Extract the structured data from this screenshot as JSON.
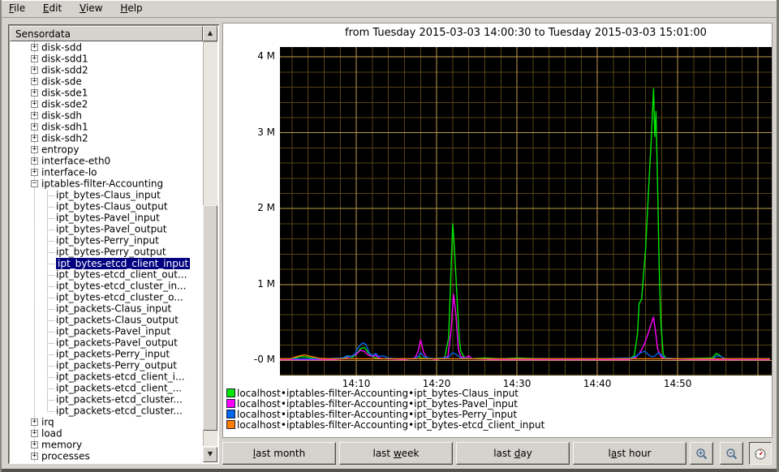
{
  "menubar": {
    "items": [
      {
        "pre": "",
        "m": "F",
        "post": "ile"
      },
      {
        "pre": "",
        "m": "E",
        "post": "dit"
      },
      {
        "pre": "",
        "m": "V",
        "post": "iew"
      },
      {
        "pre": "",
        "m": "H",
        "post": "elp"
      }
    ]
  },
  "sidebar": {
    "header": "Sensordata",
    "items": [
      {
        "label": "disk-sdd",
        "level": 0,
        "expander": "plus"
      },
      {
        "label": "disk-sdd1",
        "level": 0,
        "expander": "plus"
      },
      {
        "label": "disk-sdd2",
        "level": 0,
        "expander": "plus"
      },
      {
        "label": "disk-sde",
        "level": 0,
        "expander": "plus"
      },
      {
        "label": "disk-sde1",
        "level": 0,
        "expander": "plus"
      },
      {
        "label": "disk-sde2",
        "level": 0,
        "expander": "plus"
      },
      {
        "label": "disk-sdh",
        "level": 0,
        "expander": "plus"
      },
      {
        "label": "disk-sdh1",
        "level": 0,
        "expander": "plus"
      },
      {
        "label": "disk-sdh2",
        "level": 0,
        "expander": "plus"
      },
      {
        "label": "entropy",
        "level": 0,
        "expander": "plus"
      },
      {
        "label": "interface-eth0",
        "level": 0,
        "expander": "plus"
      },
      {
        "label": "interface-lo",
        "level": 0,
        "expander": "plus"
      },
      {
        "label": "iptables-filter-Accounting",
        "level": 0,
        "expander": "minus"
      },
      {
        "label": "ipt_bytes-Claus_input",
        "level": 1
      },
      {
        "label": "ipt_bytes-Claus_output",
        "level": 1
      },
      {
        "label": "ipt_bytes-Pavel_input",
        "level": 1
      },
      {
        "label": "ipt_bytes-Pavel_output",
        "level": 1
      },
      {
        "label": "ipt_bytes-Perry_input",
        "level": 1
      },
      {
        "label": "ipt_bytes-Perry_output",
        "level": 1
      },
      {
        "label": "ipt_bytes-etcd_client_input",
        "level": 1,
        "selected": true
      },
      {
        "label": "ipt_bytes-etcd_client_out...",
        "level": 1
      },
      {
        "label": "ipt_bytes-etcd_cluster_in...",
        "level": 1
      },
      {
        "label": "ipt_bytes-etcd_cluster_o...",
        "level": 1
      },
      {
        "label": "ipt_packets-Claus_input",
        "level": 1
      },
      {
        "label": "ipt_packets-Claus_output",
        "level": 1
      },
      {
        "label": "ipt_packets-Pavel_input",
        "level": 1
      },
      {
        "label": "ipt_packets-Pavel_output",
        "level": 1
      },
      {
        "label": "ipt_packets-Perry_input",
        "level": 1
      },
      {
        "label": "ipt_packets-Perry_output",
        "level": 1
      },
      {
        "label": "ipt_packets-etcd_client_i...",
        "level": 1
      },
      {
        "label": "ipt_packets-etcd_client_...",
        "level": 1
      },
      {
        "label": "ipt_packets-etcd_cluster...",
        "level": 1
      },
      {
        "label": "ipt_packets-etcd_cluster...",
        "level": 1
      },
      {
        "label": "irq",
        "level": 0,
        "expander": "plus"
      },
      {
        "label": "load",
        "level": 0,
        "expander": "plus"
      },
      {
        "label": "memory",
        "level": 0,
        "expander": "plus"
      },
      {
        "label": "processes",
        "level": 0,
        "expander": "plus"
      }
    ]
  },
  "chart_data": {
    "type": "line",
    "title": "from Tuesday 2015-03-03 14:00:30 to Tuesday 2015-03-03 15:01:00",
    "xlabel": "",
    "ylabel": "",
    "x_unit": "minutes after 14:00",
    "x_range": [
      0.5,
      61.7
    ],
    "y_range_M": [
      -0.2,
      4.13
    ],
    "plot_bg": "#000000",
    "grid": {
      "minor_color": "#564413",
      "major_color": "#bf9b4f",
      "minor_dx_min": 2,
      "major_dx_min": 10,
      "minor_dy_M": 0.2,
      "major_dy_M": 1
    },
    "yticks": [
      {
        "v": 4,
        "label": "4 M"
      },
      {
        "v": 3,
        "label": "3 M"
      },
      {
        "v": 2,
        "label": "2 M"
      },
      {
        "v": 1,
        "label": "1 M"
      },
      {
        "v": 0,
        "label": "-0 M"
      }
    ],
    "xticks": [
      {
        "t": 10,
        "label": "14:10"
      },
      {
        "t": 20,
        "label": "14:20"
      },
      {
        "t": 30,
        "label": "14:30"
      },
      {
        "t": 40,
        "label": "14:40"
      },
      {
        "t": 50,
        "label": "14:50"
      }
    ],
    "series": [
      {
        "name": "localhost•iptables-filter-Accounting•ipt_bytes-Claus_input",
        "color": "#00e800",
        "points": [
          [
            0.5,
            0.02
          ],
          [
            2,
            0.02
          ],
          [
            2.5,
            0.03
          ],
          [
            3,
            0.05
          ],
          [
            4,
            0.04
          ],
          [
            5,
            0.02
          ],
          [
            7,
            0.02
          ],
          [
            8.5,
            0.03
          ],
          [
            9,
            0.06
          ],
          [
            9.5,
            0.04
          ],
          [
            10,
            0.08
          ],
          [
            10.5,
            0.15
          ],
          [
            11,
            0.17
          ],
          [
            11.5,
            0.1
          ],
          [
            12,
            0.05
          ],
          [
            12.5,
            0.03
          ],
          [
            13,
            0.02
          ],
          [
            14,
            0.02
          ],
          [
            17,
            0.02
          ],
          [
            17.8,
            0.05
          ],
          [
            18,
            0.03
          ],
          [
            19,
            0.02
          ],
          [
            21,
            0.03
          ],
          [
            21.5,
            0.3
          ],
          [
            22,
            1.8
          ],
          [
            22.2,
            1.5
          ],
          [
            22.4,
            1.1
          ],
          [
            22.8,
            0.3
          ],
          [
            23,
            0.12
          ],
          [
            23.5,
            0.03
          ],
          [
            24,
            0.02
          ],
          [
            26,
            0.03
          ],
          [
            28,
            0.02
          ],
          [
            30,
            0.03
          ],
          [
            33,
            0.02
          ],
          [
            36,
            0.02
          ],
          [
            40,
            0.02
          ],
          [
            44,
            0.02
          ],
          [
            44.6,
            0.06
          ],
          [
            45,
            0.35
          ],
          [
            45.2,
            0.75
          ],
          [
            45.5,
            0.8
          ],
          [
            46,
            1.45
          ],
          [
            46.4,
            2.3
          ],
          [
            46.7,
            2.9
          ],
          [
            47,
            3.58
          ],
          [
            47.15,
            2.95
          ],
          [
            47.3,
            3.28
          ],
          [
            47.5,
            2.3
          ],
          [
            47.7,
            1.2
          ],
          [
            47.9,
            0.5
          ],
          [
            48.2,
            0.08
          ],
          [
            48.5,
            0.03
          ],
          [
            50,
            0.02
          ],
          [
            54.3,
            0.03
          ],
          [
            54.8,
            0.09
          ],
          [
            55.3,
            0.06
          ],
          [
            55.8,
            0.02
          ],
          [
            58,
            0.02
          ],
          [
            61.5,
            0.02
          ]
        ]
      },
      {
        "name": "localhost•iptables-filter-Accounting•ipt_bytes-Pavel_input",
        "color": "#ff00ff",
        "points": [
          [
            0.5,
            0.01
          ],
          [
            7,
            0.01
          ],
          [
            8.5,
            0.02
          ],
          [
            9,
            0.04
          ],
          [
            9.5,
            0.06
          ],
          [
            10,
            0.08
          ],
          [
            10.5,
            0.13
          ],
          [
            11,
            0.12
          ],
          [
            11.5,
            0.07
          ],
          [
            12,
            0.05
          ],
          [
            12.4,
            0.07
          ],
          [
            12.8,
            0.03
          ],
          [
            13.5,
            0.02
          ],
          [
            16,
            0.01
          ],
          [
            17.3,
            0.03
          ],
          [
            17.7,
            0.12
          ],
          [
            18,
            0.27
          ],
          [
            18.4,
            0.1
          ],
          [
            18.8,
            0.03
          ],
          [
            20,
            0.01
          ],
          [
            21.4,
            0.05
          ],
          [
            21.8,
            0.4
          ],
          [
            22.1,
            0.87
          ],
          [
            22.4,
            0.6
          ],
          [
            22.7,
            0.15
          ],
          [
            23,
            0.05
          ],
          [
            23.6,
            0.03
          ],
          [
            24,
            0.06
          ],
          [
            24.4,
            0.02
          ],
          [
            27,
            0.01
          ],
          [
            35,
            0.01
          ],
          [
            44,
            0.01
          ],
          [
            44.8,
            0.04
          ],
          [
            45.3,
            0.1
          ],
          [
            45.8,
            0.2
          ],
          [
            46.3,
            0.35
          ],
          [
            46.7,
            0.48
          ],
          [
            47,
            0.57
          ],
          [
            47.2,
            0.42
          ],
          [
            47.5,
            0.15
          ],
          [
            47.9,
            0.05
          ],
          [
            48.4,
            0.02
          ],
          [
            52,
            0.01
          ],
          [
            61.5,
            0.01
          ]
        ]
      },
      {
        "name": "localhost•iptables-filter-Accounting•ipt_bytes-Perry_input",
        "color": "#0066ee",
        "points": [
          [
            0.5,
            0.02
          ],
          [
            6,
            0.02
          ],
          [
            8.3,
            0.03
          ],
          [
            8.8,
            0.06
          ],
          [
            9.2,
            0.04
          ],
          [
            9.8,
            0.08
          ],
          [
            10.3,
            0.18
          ],
          [
            10.8,
            0.23
          ],
          [
            11.2,
            0.21
          ],
          [
            11.6,
            0.1
          ],
          [
            12,
            0.06
          ],
          [
            12.4,
            0.09
          ],
          [
            12.8,
            0.05
          ],
          [
            13.4,
            0.06
          ],
          [
            13.9,
            0.03
          ],
          [
            15,
            0.02
          ],
          [
            17.2,
            0.02
          ],
          [
            17.7,
            0.05
          ],
          [
            18,
            0.1
          ],
          [
            18.4,
            0.05
          ],
          [
            19,
            0.03
          ],
          [
            20,
            0.02
          ],
          [
            21.5,
            0.04
          ],
          [
            22,
            0.1
          ],
          [
            22.4,
            0.08
          ],
          [
            23,
            0.03
          ],
          [
            25,
            0.02
          ],
          [
            30,
            0.02
          ],
          [
            35,
            0.02
          ],
          [
            40,
            0.02
          ],
          [
            44.3,
            0.03
          ],
          [
            44.9,
            0.06
          ],
          [
            45.4,
            0.1
          ],
          [
            45.9,
            0.12
          ],
          [
            46.3,
            0.08
          ],
          [
            46.7,
            0.05
          ],
          [
            47.1,
            0.05
          ],
          [
            47.6,
            0.1
          ],
          [
            48,
            0.07
          ],
          [
            48.4,
            0.03
          ],
          [
            50,
            0.02
          ],
          [
            54.4,
            0.02
          ],
          [
            54.9,
            0.06
          ],
          [
            55.4,
            0.05
          ],
          [
            55.9,
            0.02
          ],
          [
            58,
            0.02
          ],
          [
            61.5,
            0.02
          ]
        ]
      },
      {
        "name": "localhost•iptables-filter-Accounting•ipt_bytes-etcd_client_input",
        "color": "#ff7d00",
        "points": [
          [
            0.5,
            0.02
          ],
          [
            1.8,
            0.02
          ],
          [
            2.3,
            0.04
          ],
          [
            3,
            0.06
          ],
          [
            3.5,
            0.07
          ],
          [
            4,
            0.06
          ],
          [
            4.8,
            0.04
          ],
          [
            5.5,
            0.025
          ],
          [
            6.5,
            0.02
          ],
          [
            61.5,
            0.02
          ]
        ]
      }
    ]
  },
  "toolbar": {
    "buttons": [
      {
        "pre": "",
        "m": "l",
        "post": "ast month"
      },
      {
        "pre": "last ",
        "m": "w",
        "post": "eek"
      },
      {
        "pre": "last ",
        "m": "d",
        "post": "ay"
      },
      {
        "pre": "l",
        "m": "a",
        "post": "st hour"
      }
    ]
  }
}
